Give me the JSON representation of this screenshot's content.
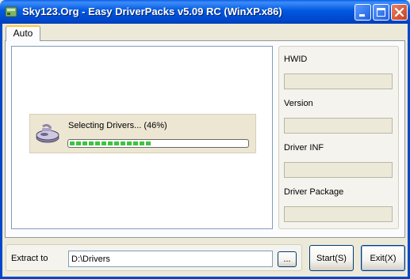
{
  "window": {
    "title": "Sky123.Org - Easy DriverPacks v5.09 RC (WinXP.x86)"
  },
  "tabs": [
    {
      "label": "Auto",
      "active": true
    }
  ],
  "progress": {
    "label": "Selecting Drivers... (46%)",
    "percent": 46
  },
  "info": {
    "hwid_label": "HWID",
    "version_label": "Version",
    "driver_inf_label": "Driver INF",
    "driver_package_label": "Driver Package"
  },
  "extract": {
    "label": "Extract to",
    "path": "D:\\Drivers",
    "browse_label": "..."
  },
  "buttons": {
    "start": "Start(S)",
    "exit": "Exit(X)"
  },
  "colors": {
    "titlebar": "#0058E0",
    "progress_fill": "#3FC33F",
    "face": "#ECE9D8"
  }
}
